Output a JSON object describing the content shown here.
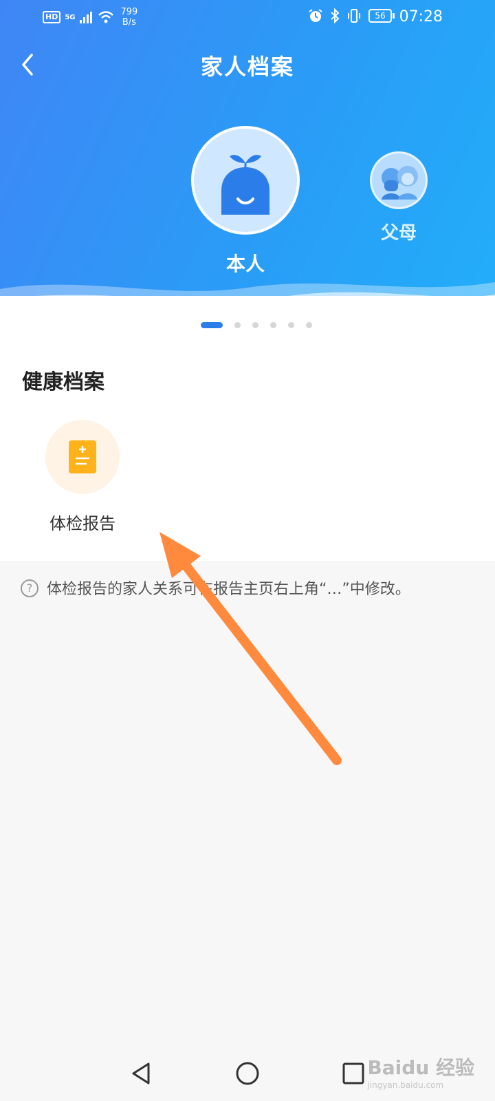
{
  "status_bar": {
    "hd": "HD",
    "network": "5G",
    "speed_value": "799",
    "speed_unit": "B/s",
    "battery": "56",
    "time": "07:28"
  },
  "header": {
    "title": "家人档案"
  },
  "members": [
    {
      "label": "本人",
      "selected": true
    },
    {
      "label": "父母",
      "selected": false
    }
  ],
  "pagination": {
    "count": 6,
    "active_index": 0
  },
  "health": {
    "section_title": "健康档案",
    "report_label": "体检报告"
  },
  "hint": {
    "text": "体检报告的家人关系可在报告主页右上角“…”中修改。"
  },
  "watermark": {
    "brand": "Baidu 经验",
    "url": "jingyan.baidu.com"
  },
  "colors": {
    "primary": "#2b7de9",
    "annotation_arrow": "#ff8a3d",
    "report_icon": "#ffb21a"
  }
}
